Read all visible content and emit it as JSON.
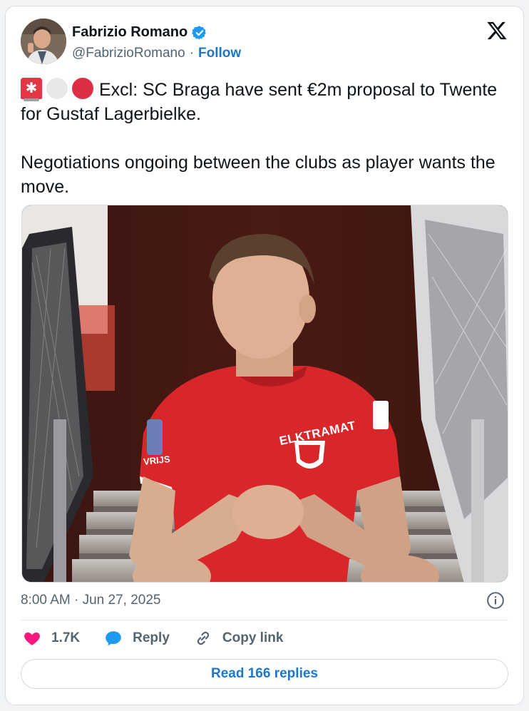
{
  "author": {
    "name": "Fabrizio Romano",
    "handle": "@FabrizioRomano",
    "separator": "·",
    "follow_label": "Follow",
    "verified": true
  },
  "tweet": {
    "emojis": [
      "rotating-light-emoji",
      "white-circle-emoji",
      "red-circle-emoji"
    ],
    "line1": "Excl: SC Braga have sent €2m proposal to Twente for Gustaf Lagerbielke.",
    "line2": "Negotiations ongoing between the clubs as player wants the move."
  },
  "meta": {
    "timestamp": "8:00 AM · Jun 27, 2025"
  },
  "actions": {
    "likes": "1.7K",
    "reply_label": "Reply",
    "copy_link_label": "Copy link"
  },
  "read_replies_label": "Read 166 replies",
  "media": {
    "shirt_sponsor": "ELKTRAMAT",
    "sleeve_text": "VRIJS"
  },
  "colors": {
    "accent": "#1d76c8",
    "like": "#f91880",
    "shirt_red": "#d8262a"
  }
}
